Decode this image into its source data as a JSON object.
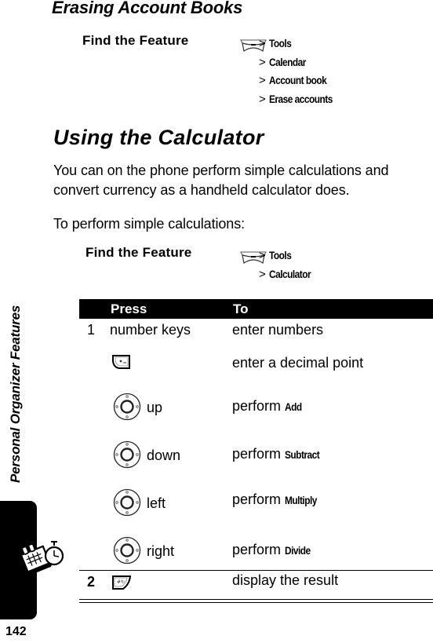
{
  "side_tab": {
    "title": "Personal Organizer Features",
    "icon": "organizer-calendar-stopwatch-icon",
    "page_number": "142"
  },
  "section1": {
    "heading": "Erasing Account Books",
    "find_feature": {
      "label": "Find the Feature",
      "key_icon": "menu-key-icon",
      "path": [
        "Tools",
        "Calendar",
        "Account book",
        "Erase accounts"
      ]
    }
  },
  "section2": {
    "heading": "Using the Calculator",
    "intro": "You can on the phone perform simple calculations and convert currency as a handheld calculator does.",
    "intro_line1": "You can on the phone perform simple calculations and",
    "intro_line2": "convert currency as a handheld calculator does.",
    "lead": "To perform simple calculations:",
    "find_feature": {
      "label": "Find the Feature",
      "key_icon": "menu-key-icon",
      "path": [
        "Tools",
        "Calculator"
      ]
    },
    "table": {
      "headers": {
        "press": "Press",
        "to": "To"
      },
      "rows": [
        {
          "step": "1",
          "press": "number keys",
          "press_icon": null,
          "to": "enter numbers",
          "to_emph": ""
        },
        {
          "step": "",
          "press": "",
          "press_icon": "left-soft-key-icon",
          "to": "enter a decimal point",
          "to_emph": ""
        },
        {
          "step": "",
          "press": "up",
          "press_icon": "nav-key-icon",
          "to": "perform ",
          "to_emph": "Add"
        },
        {
          "step": "",
          "press": "down",
          "press_icon": "nav-key-icon",
          "to": "perform ",
          "to_emph": "Subtract"
        },
        {
          "step": "",
          "press": "left",
          "press_icon": "nav-key-icon",
          "to": "perform ",
          "to_emph": "Multiply"
        },
        {
          "step": "",
          "press": "right",
          "press_icon": "nav-key-icon",
          "to": "perform ",
          "to_emph": "Divide"
        },
        {
          "step": "2",
          "press": "",
          "press_icon": "right-soft-key-icon",
          "to": "display the result",
          "to_emph": ""
        }
      ]
    }
  },
  "path_separator": ">"
}
